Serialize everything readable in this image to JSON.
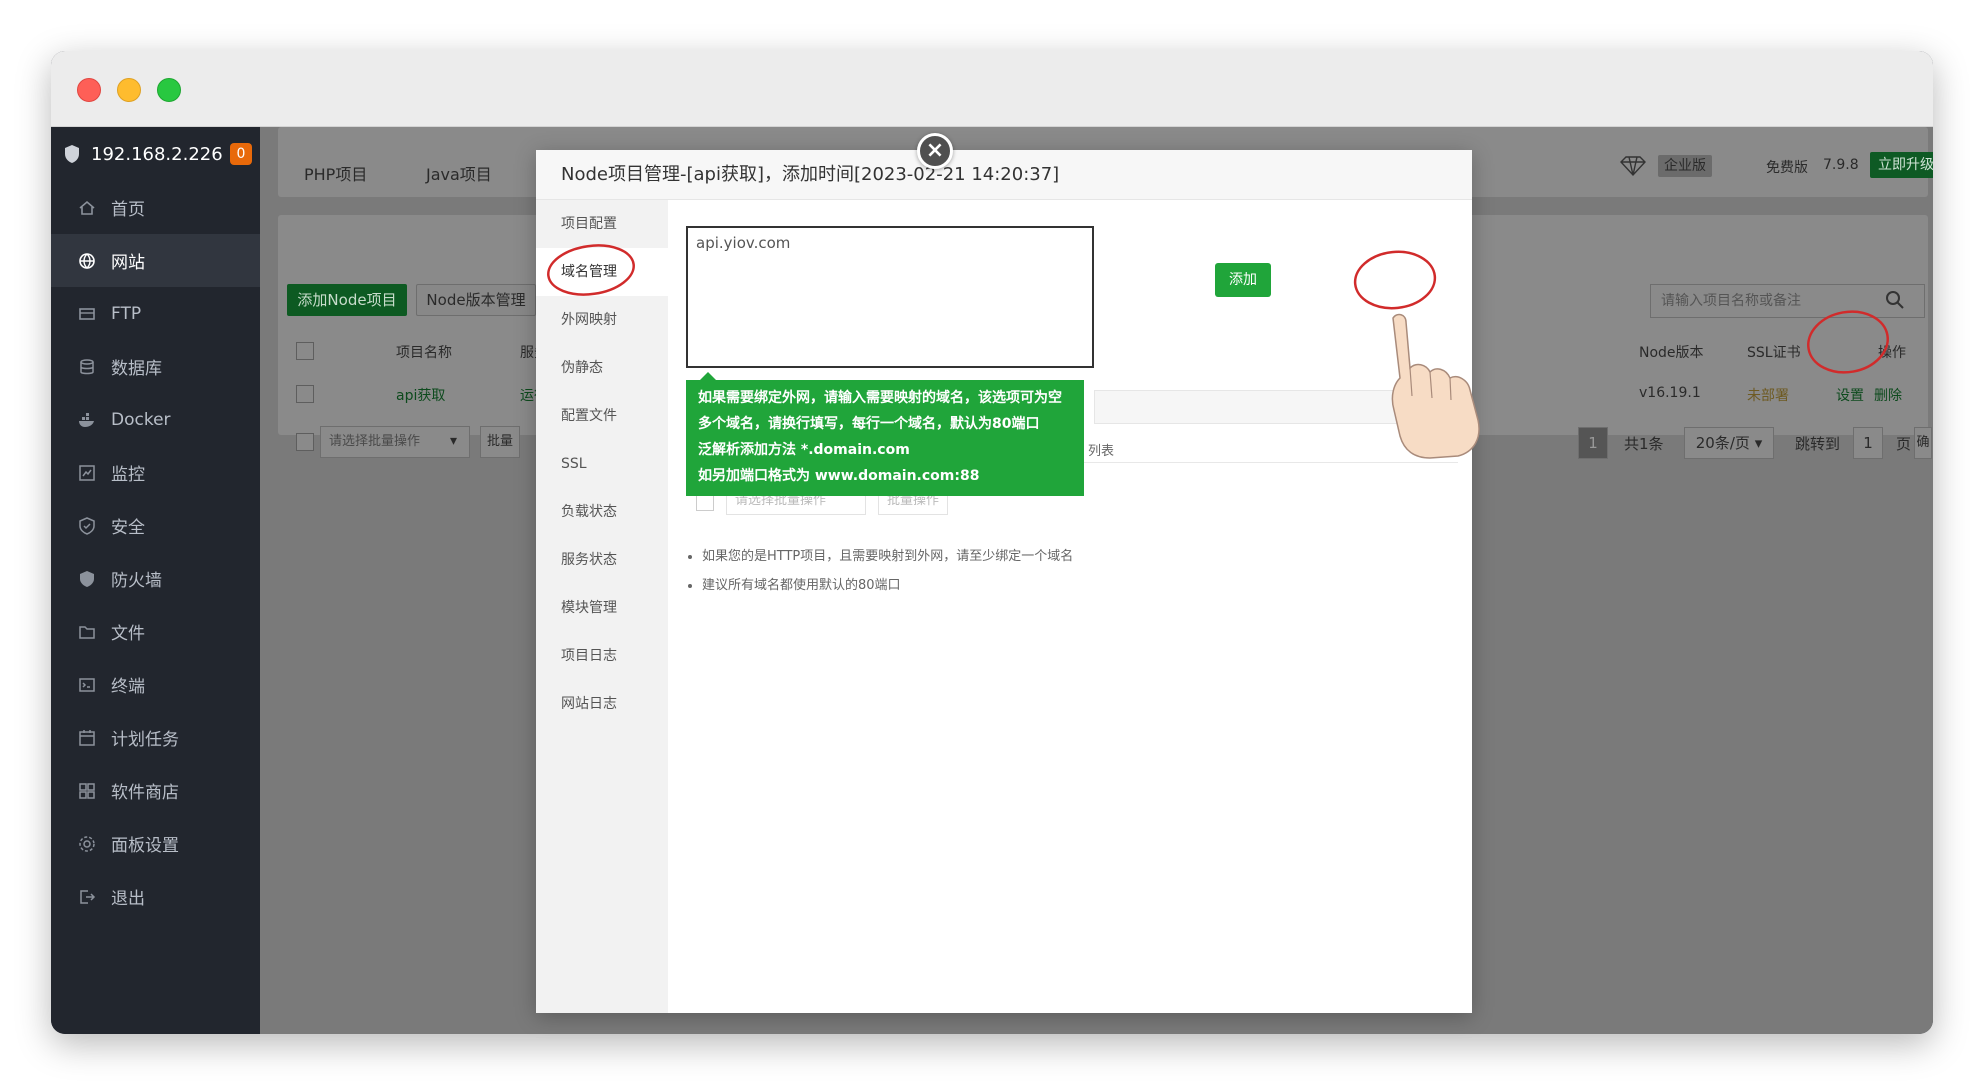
{
  "sidebar": {
    "host": "192.168.2.226",
    "badge": "0",
    "items": [
      {
        "label": "首页",
        "icon": "home-icon"
      },
      {
        "label": "网站",
        "icon": "globe-icon"
      },
      {
        "label": "FTP",
        "icon": "ftp-icon"
      },
      {
        "label": "数据库",
        "icon": "database-icon"
      },
      {
        "label": "Docker",
        "icon": "docker-icon"
      },
      {
        "label": "监控",
        "icon": "monitor-icon"
      },
      {
        "label": "安全",
        "icon": "security-icon"
      },
      {
        "label": "防火墙",
        "icon": "firewall-icon"
      },
      {
        "label": "文件",
        "icon": "folder-icon"
      },
      {
        "label": "终端",
        "icon": "terminal-icon"
      },
      {
        "label": "计划任务",
        "icon": "calendar-icon"
      },
      {
        "label": "软件商店",
        "icon": "apps-icon"
      },
      {
        "label": "面板设置",
        "icon": "gear-icon"
      },
      {
        "label": "退出",
        "icon": "logout-icon"
      }
    ]
  },
  "topbar": {
    "tabs": [
      "PHP项目",
      "Java项目"
    ],
    "enterprise": "企业版",
    "free": "免费版",
    "version": "7.9.8",
    "upgrade": "立即升级"
  },
  "panel": {
    "add_node": "添加Node项目",
    "node_version_mgr": "Node版本管理",
    "search_placeholder": "请输入项目名称或备注",
    "columns": {
      "name": "项目名称",
      "status": "服务状态",
      "node_version": "Node版本",
      "ssl": "SSL证书",
      "ops": "操作"
    },
    "row": {
      "name": "api获取",
      "status": "运行中",
      "node_version": "v16.19.1",
      "ssl": "未部署",
      "set": "设置",
      "delete": "删除"
    },
    "batch_placeholder": "请选择批量操作",
    "batch_btn": "批量",
    "pagination": {
      "page": "1",
      "total": "共1条",
      "per_page": "20条/页",
      "goto": "跳转到",
      "goto_value": "1",
      "page_unit": "页",
      "confirm": "确认"
    }
  },
  "dialog": {
    "title": "Node项目管理-[api获取]，添加时间[2023-02-21 14:20:37]",
    "menu": [
      "项目配置",
      "域名管理",
      "外网映射",
      "伪静态",
      "配置文件",
      "SSL",
      "负载状态",
      "服务状态",
      "模块管理",
      "项目日志",
      "网站日志"
    ],
    "active_menu": "域名管理",
    "textarea_value": "api.yiov.com",
    "add_button": "添加",
    "tooltip_lines": [
      "如果需要绑定外网，请输入需要映射的域名，该选项可为空",
      "多个域名，请换行填写，每行一个域名，默认为80端口",
      "泛解析添加方法 *.domain.com",
      "如另加端口格式为 www.domain.com:88"
    ],
    "list_suffix": "列表",
    "batch_placeholder": "请选择批量操作",
    "batch_btn": "批量操作",
    "tips": [
      "如果您的是HTTP项目，且需要映射到外网，请至少绑定一个域名",
      "建议所有域名都使用默认的80端口"
    ]
  }
}
